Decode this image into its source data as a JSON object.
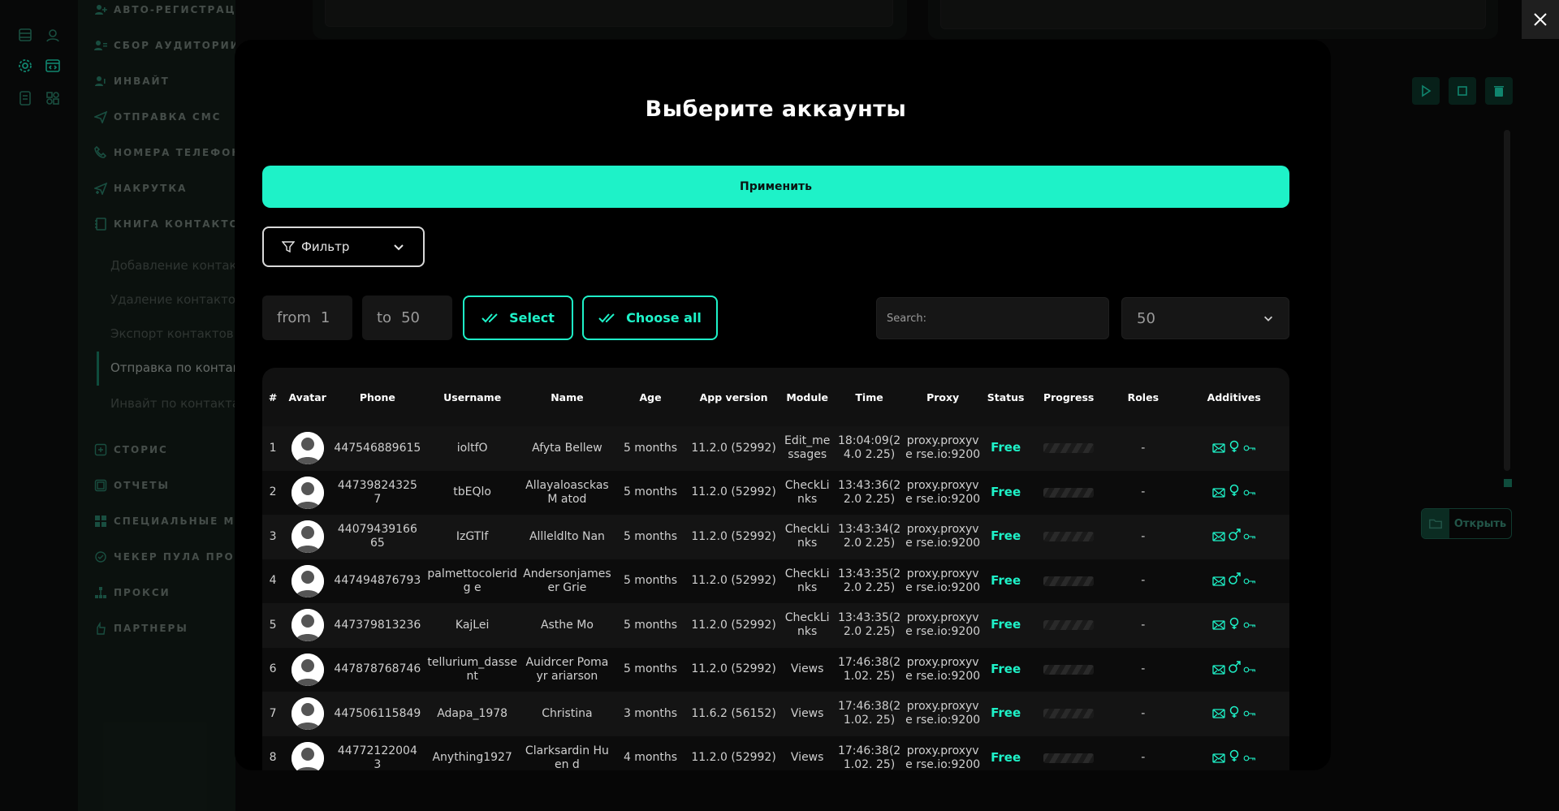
{
  "background": {
    "sidebar_items": [
      {
        "label": "АВТО-РЕГИСТРАЦИЯ",
        "icon": "user-plus-icon"
      },
      {
        "label": "СБОР АУДИТОРИИ",
        "icon": "users-icon"
      },
      {
        "label": "ИНВАЙТ",
        "icon": "user-add-icon"
      },
      {
        "label": "ОТПРАВКА СМС",
        "icon": "send-icon"
      },
      {
        "label": "НОМЕРА ТЕЛЕФОНО",
        "icon": "phone-icon"
      },
      {
        "label": "НАКРУТКА",
        "icon": "send-plus-icon"
      },
      {
        "label": "КНИГА КОНТАКТОВ",
        "icon": "book-icon"
      }
    ],
    "sub_items": [
      "Добавление контакт",
      "Удаление контактов",
      "Экспорт контактов",
      "Отправка по контакт",
      "Инвайт по контактам"
    ],
    "sidebar_items_bottom": [
      {
        "label": "СТОРИС",
        "icon": "plus-square-icon"
      },
      {
        "label": "ОТЧЕТЫ",
        "icon": "report-icon"
      },
      {
        "label": "СПЕЦИАЛЬНЫЕ МОД",
        "icon": "grid-icon"
      },
      {
        "label": "ЧЕКЕР ПУЛА ПРОКС",
        "icon": "checker-icon"
      },
      {
        "label": "ПРОКСИ",
        "icon": "network-icon"
      },
      {
        "label": "ПАРТНЕРЫ",
        "icon": "hand-icon"
      }
    ],
    "open_label": "Открыть"
  },
  "modal": {
    "title": "Выберите аккаунты",
    "apply_label": "Применить",
    "filter_label": "Фильтр",
    "from_label": "from",
    "from_value": "1",
    "to_label": "to",
    "to_value": "50",
    "select_label": "Select",
    "choose_all_label": "Choose all",
    "search_placeholder": "Search:",
    "per_page": "50",
    "accent": "#1ef2c8",
    "columns": [
      "#",
      "Avatar",
      "Phone",
      "Username",
      "Name",
      "Age",
      "App version",
      "Module",
      "Time",
      "Proxy",
      "Status",
      "Progress",
      "Roles",
      "Additives"
    ],
    "rows": [
      {
        "num": "1",
        "phone": "447546889615",
        "username": "ioltfO",
        "name": "Afyta Bellew",
        "age": "5 months",
        "app": "11.2.0 (52992)",
        "module": "Edit_me ssages",
        "time": "18:04:09(24.0 2.25)",
        "proxy": "proxy.proxyve rse.io:9200",
        "status": "Free",
        "roles": "-",
        "gender": "female"
      },
      {
        "num": "2",
        "phone": "44739824325 7",
        "username": "tbEQlo",
        "name": "Allayaloasckas M atod",
        "age": "5 months",
        "app": "11.2.0 (52992)",
        "module": "CheckLi nks",
        "time": "13:43:36(22.0 2.25)",
        "proxy": "proxy.proxyve rse.io:9200",
        "status": "Free",
        "roles": "-",
        "gender": "female"
      },
      {
        "num": "3",
        "phone": "44079439166 65",
        "username": "IzGTIf",
        "name": "Allleldlto Nan",
        "age": "5 months",
        "app": "11.2.0 (52992)",
        "module": "CheckLi nks",
        "time": "13:43:34(22.0 2.25)",
        "proxy": "proxy.proxyve rse.io:9200",
        "status": "Free",
        "roles": "-",
        "gender": "male"
      },
      {
        "num": "4",
        "phone": "447494876793",
        "username": "palmettocoleridg e",
        "name": "Andersonjameser Grie",
        "age": "5 months",
        "app": "11.2.0 (52992)",
        "module": "CheckLi nks",
        "time": "13:43:35(22.0 2.25)",
        "proxy": "proxy.proxyve rse.io:9200",
        "status": "Free",
        "roles": "-",
        "gender": "male"
      },
      {
        "num": "5",
        "phone": "447379813236",
        "username": "KajLei",
        "name": "Asthe Mo",
        "age": "5 months",
        "app": "11.2.0 (52992)",
        "module": "CheckLi nks",
        "time": "13:43:35(22.0 2.25)",
        "proxy": "proxy.proxyve rse.io:9200",
        "status": "Free",
        "roles": "-",
        "gender": "female"
      },
      {
        "num": "6",
        "phone": "447878768746",
        "username": "tellurium_dassent",
        "name": "Auidrcer Pomayr ariarson",
        "age": "5 months",
        "app": "11.2.0 (52992)",
        "module": "Views",
        "time": "17:46:38(21.02. 25)",
        "proxy": "proxy.proxyve rse.io:9200",
        "status": "Free",
        "roles": "-",
        "gender": "male"
      },
      {
        "num": "7",
        "phone": "447506115849",
        "username": "Adapa_1978",
        "name": "Christina",
        "age": "3 months",
        "app": "11.6.2 (56152)",
        "module": "Views",
        "time": "17:46:38(21.02. 25)",
        "proxy": "proxy.proxyve rse.io:9200",
        "status": "Free",
        "roles": "-",
        "gender": "female"
      },
      {
        "num": "8",
        "phone": "44772122004 3",
        "username": "Anything1927",
        "name": "Clarksardin Huen d",
        "age": "4 months",
        "app": "11.2.0 (52992)",
        "module": "Views",
        "time": "17:46:38(21.02. 25)",
        "proxy": "proxy.proxyve rse.io:9200",
        "status": "Free",
        "roles": "-",
        "gender": "female"
      }
    ]
  }
}
